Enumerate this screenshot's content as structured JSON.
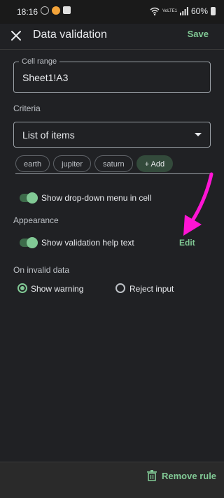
{
  "status_bar": {
    "time": "18:16",
    "battery": "60%",
    "network": "VoLTE1"
  },
  "header": {
    "title": "Data validation",
    "save_label": "Save"
  },
  "cell_range": {
    "label": "Cell range",
    "value": "Sheet1!A3"
  },
  "criteria": {
    "label": "Criteria",
    "selected": "List of items",
    "items": [
      "earth",
      "jupiter",
      "saturn"
    ],
    "add_label": "+ Add"
  },
  "dropdown_toggle": {
    "label": "Show drop-down menu in cell",
    "on": true
  },
  "appearance": {
    "label": "Appearance",
    "help_text_toggle": {
      "label": "Show validation help text",
      "on": true
    },
    "edit_label": "Edit"
  },
  "invalid_data": {
    "label": "On invalid data",
    "options": [
      {
        "label": "Show warning",
        "selected": true
      },
      {
        "label": "Reject input",
        "selected": false
      }
    ]
  },
  "footer": {
    "remove_label": "Remove rule"
  },
  "colors": {
    "accent": "#81c995",
    "background": "#202124",
    "annotation_arrow": "#ff14d4"
  }
}
